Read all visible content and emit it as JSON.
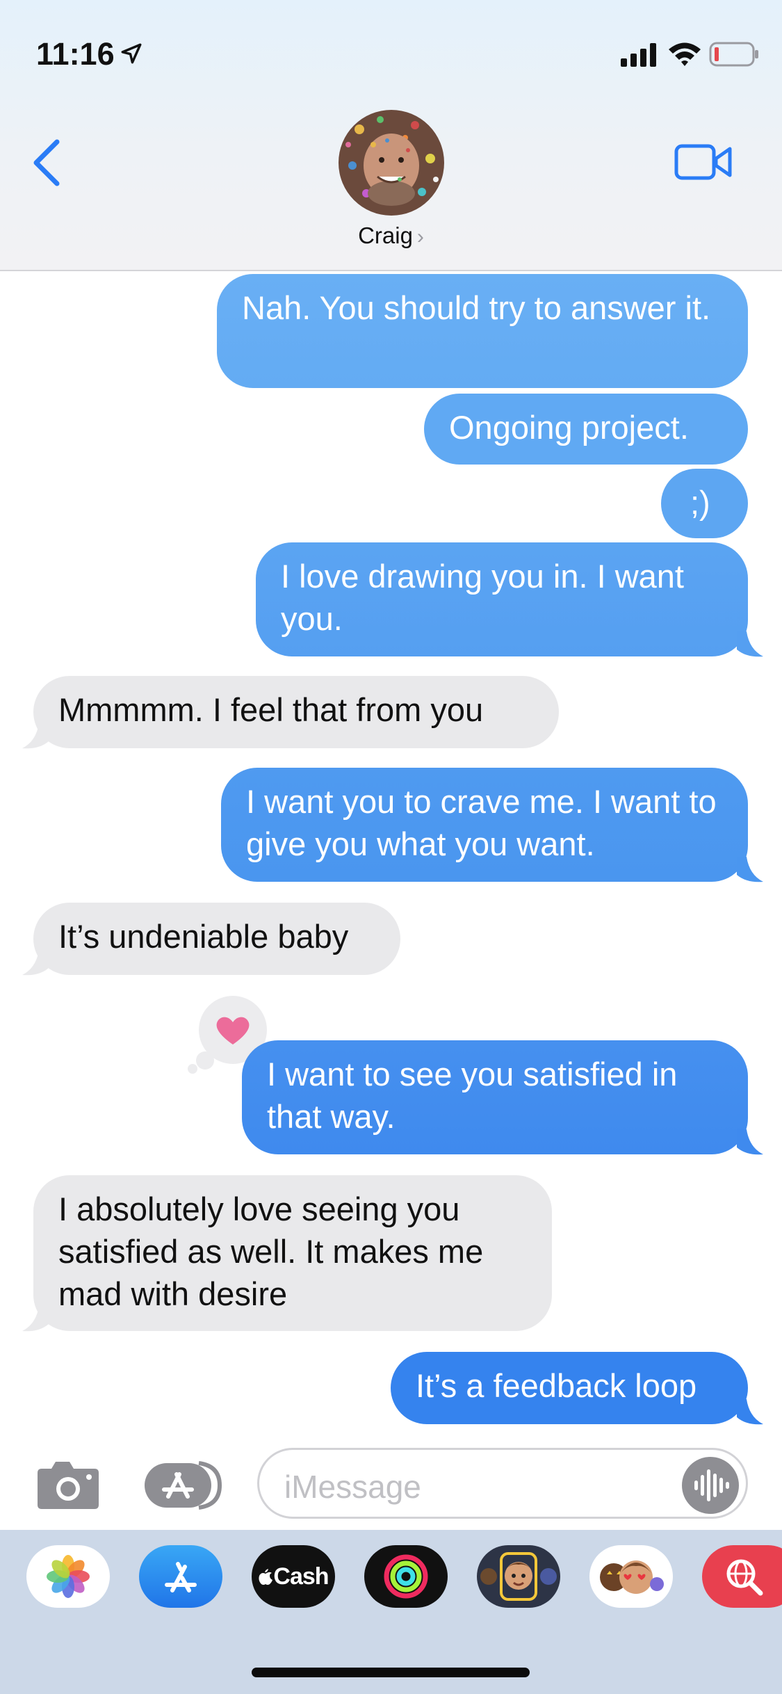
{
  "status_bar": {
    "time": "11:16"
  },
  "header": {
    "contact_name": "Craig",
    "chevron": "›"
  },
  "colors": {
    "sent_top": "#67adf3",
    "sent_bottom": "#2f7bef",
    "received": "#e9e9eb",
    "accent": "#2a7cf6",
    "heart": "#ec6c9a"
  },
  "messages": [
    {
      "from": "me",
      "text": "Nah. You should try to answer it."
    },
    {
      "from": "me",
      "text": "Ongoing project."
    },
    {
      "from": "me",
      "text": ";)"
    },
    {
      "from": "me",
      "text": "I love drawing you in. I want you."
    },
    {
      "from": "craig",
      "text": "Mmmmm.  I feel that from you"
    },
    {
      "from": "me",
      "text": "I want you to crave me. I want to give you what you want."
    },
    {
      "from": "craig",
      "text": "It’s undeniable baby"
    },
    {
      "from": "me",
      "text": "I want to see you satisfied in that way.",
      "tapback": "heart-icon"
    },
    {
      "from": "craig",
      "text": "I absolutely love seeing you satisfied as well. It makes me mad with desire"
    },
    {
      "from": "me",
      "text": "It’s a feedback loop"
    }
  ],
  "input": {
    "placeholder": "iMessage"
  },
  "app_drawer": {
    "apps": [
      "photos-icon",
      "app-store-icon",
      "apple-cash-icon",
      "activity-icon",
      "memoji-icon",
      "animoji-stickers-icon",
      "web-search-icon"
    ],
    "cash_label": "Cash"
  }
}
